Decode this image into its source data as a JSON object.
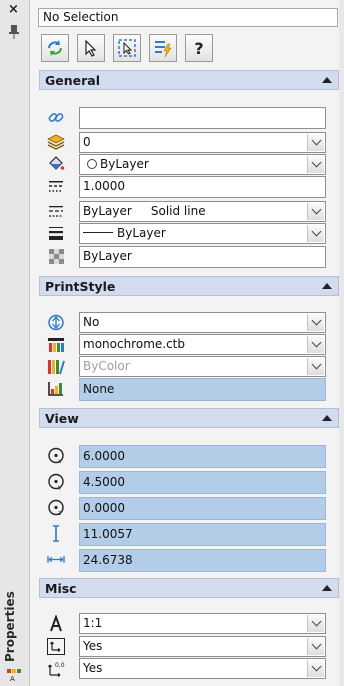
{
  "panel": {
    "title": "Properties",
    "close_glyph": "×"
  },
  "selection": {
    "value": "No Selection"
  },
  "toolbar": {
    "buttons": [
      {
        "name": "toggle-pickadd-button",
        "icon": "refresh-pickadd-icon"
      },
      {
        "name": "select-objects-button",
        "icon": "cursor-arrow-icon"
      },
      {
        "name": "quick-select-button",
        "icon": "dashed-select-icon"
      },
      {
        "name": "quick-filter-button",
        "icon": "list-lightning-icon"
      },
      {
        "name": "help-button",
        "icon": "question-icon",
        "label": "?"
      }
    ]
  },
  "sections": {
    "general": {
      "title": "General",
      "rows": [
        {
          "icon": "hyperlink-icon",
          "value": ""
        },
        {
          "icon": "layers-icon",
          "value": "0"
        },
        {
          "icon": "color-bucket-icon",
          "value": "ByLayer"
        },
        {
          "icon": "linetype-scale-icon",
          "value": "1.0000"
        },
        {
          "icon": "linetype-icon",
          "value": "ByLayer     Solid line"
        },
        {
          "icon": "lineweight-icon",
          "value": "ByLayer"
        },
        {
          "icon": "transparency-icon",
          "value": "ByLayer"
        }
      ]
    },
    "printstyle": {
      "title": "PrintStyle",
      "rows": [
        {
          "icon": "plot-style-icon",
          "value": "No"
        },
        {
          "icon": "plot-table-icon",
          "value": "monochrome.ctb"
        },
        {
          "icon": "plot-table-attached-icon",
          "value": "ByColor"
        },
        {
          "icon": "plot-table-type-icon",
          "value": "None"
        }
      ]
    },
    "view": {
      "title": "View",
      "rows": [
        {
          "icon": "center-x-icon",
          "value": "6.0000"
        },
        {
          "icon": "center-y-icon",
          "value": "4.5000"
        },
        {
          "icon": "center-z-icon",
          "value": "0.0000"
        },
        {
          "icon": "height-icon",
          "value": "11.0057"
        },
        {
          "icon": "width-icon",
          "value": "24.6738"
        }
      ]
    },
    "misc": {
      "title": "Misc",
      "rows": [
        {
          "icon": "annotation-scale-icon",
          "value": "1:1"
        },
        {
          "icon": "ucs-icon-on-icon",
          "value": "Yes"
        },
        {
          "icon": "ucs-at-origin-icon",
          "value": "Yes"
        }
      ]
    }
  },
  "colors": {
    "section_header": "#d3dbef",
    "readonly_field": "#b3cde8",
    "accent_blue": "#1f6fc5"
  }
}
